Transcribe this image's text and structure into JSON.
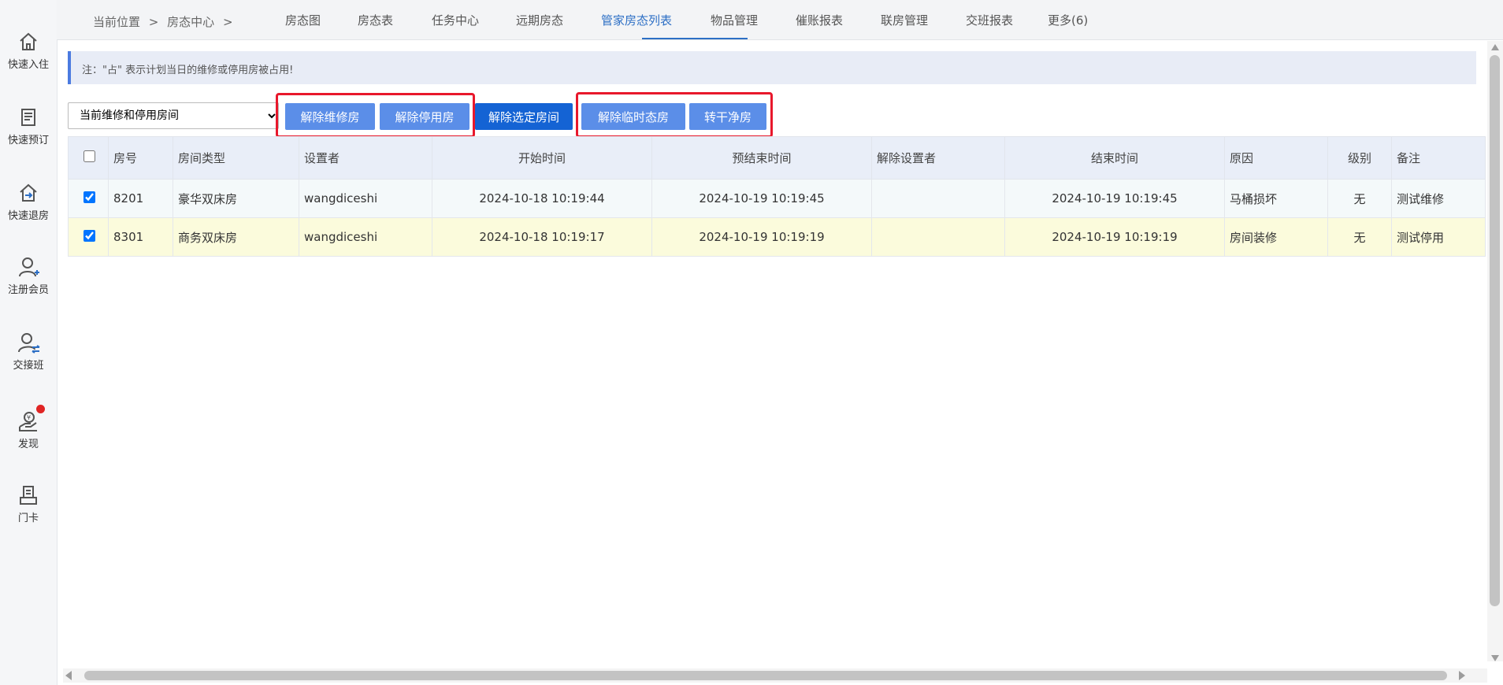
{
  "sidebar": {
    "items": [
      {
        "label": "快速入住",
        "icon": "home-icon"
      },
      {
        "label": "快速预订",
        "icon": "booking-icon"
      },
      {
        "label": "快速退房",
        "icon": "checkout-icon"
      },
      {
        "label": "注册会员",
        "icon": "add-member-icon"
      },
      {
        "label": "交接班",
        "icon": "shift-handover-icon"
      },
      {
        "label": "发现",
        "icon": "discover-icon"
      },
      {
        "label": "门卡",
        "icon": "door-card-icon"
      }
    ]
  },
  "header": {
    "breadcrumb": [
      "当前位置",
      ">",
      "房态中心",
      ">"
    ],
    "tabs": [
      {
        "label": "房态图"
      },
      {
        "label": "房态表"
      },
      {
        "label": "任务中心"
      },
      {
        "label": "远期房态"
      },
      {
        "label": "管家房态列表",
        "active": true
      },
      {
        "label": "物品管理"
      },
      {
        "label": "催账报表"
      },
      {
        "label": "联房管理"
      },
      {
        "label": "交班报表"
      },
      {
        "label": "更多(6)"
      }
    ]
  },
  "notice": {
    "text": "注：\"占\" 表示计划当日的维修或停用房被占用!"
  },
  "toolbar": {
    "filter": {
      "selected": "当前维修和停用房间"
    },
    "buttons": {
      "release_maintenance": "解除维修房",
      "release_disabled": "解除停用房",
      "release_selected": "解除选定房间",
      "release_temporary": "解除临时态房",
      "to_dry_clean": "转干净房"
    }
  },
  "table": {
    "columns": [
      "",
      "房号",
      "房间类型",
      "设置者",
      "开始时间",
      "预结束时间",
      "解除设置者",
      "结束时间",
      "原因",
      "级别",
      "备注"
    ],
    "rows": [
      {
        "checked": true,
        "room": "8201",
        "type": "豪华双床房",
        "setter": "wangdiceshi",
        "start": "2024-10-18 10:19:44",
        "planned_end": "2024-10-19 10:19:45",
        "releaser": "",
        "end": "2024-10-19 10:19:45",
        "reason": "马桶损坏",
        "level": "无",
        "note": "测试维修"
      },
      {
        "checked": true,
        "room": "8301",
        "type": "商务双床房",
        "setter": "wangdiceshi",
        "start": "2024-10-18 10:19:17",
        "planned_end": "2024-10-19 10:19:19",
        "releaser": "",
        "end": "2024-10-19 10:19:19",
        "reason": "房间装修",
        "level": "无",
        "note": "测试停用"
      }
    ]
  },
  "colors": {
    "accent": "#2d6fc5",
    "button": "#5b8ee8",
    "button_dark": "#1463d4",
    "highlight_box": "#e8182c",
    "row_alt": "#fbfbdc",
    "notify_dot": "#e02424"
  }
}
